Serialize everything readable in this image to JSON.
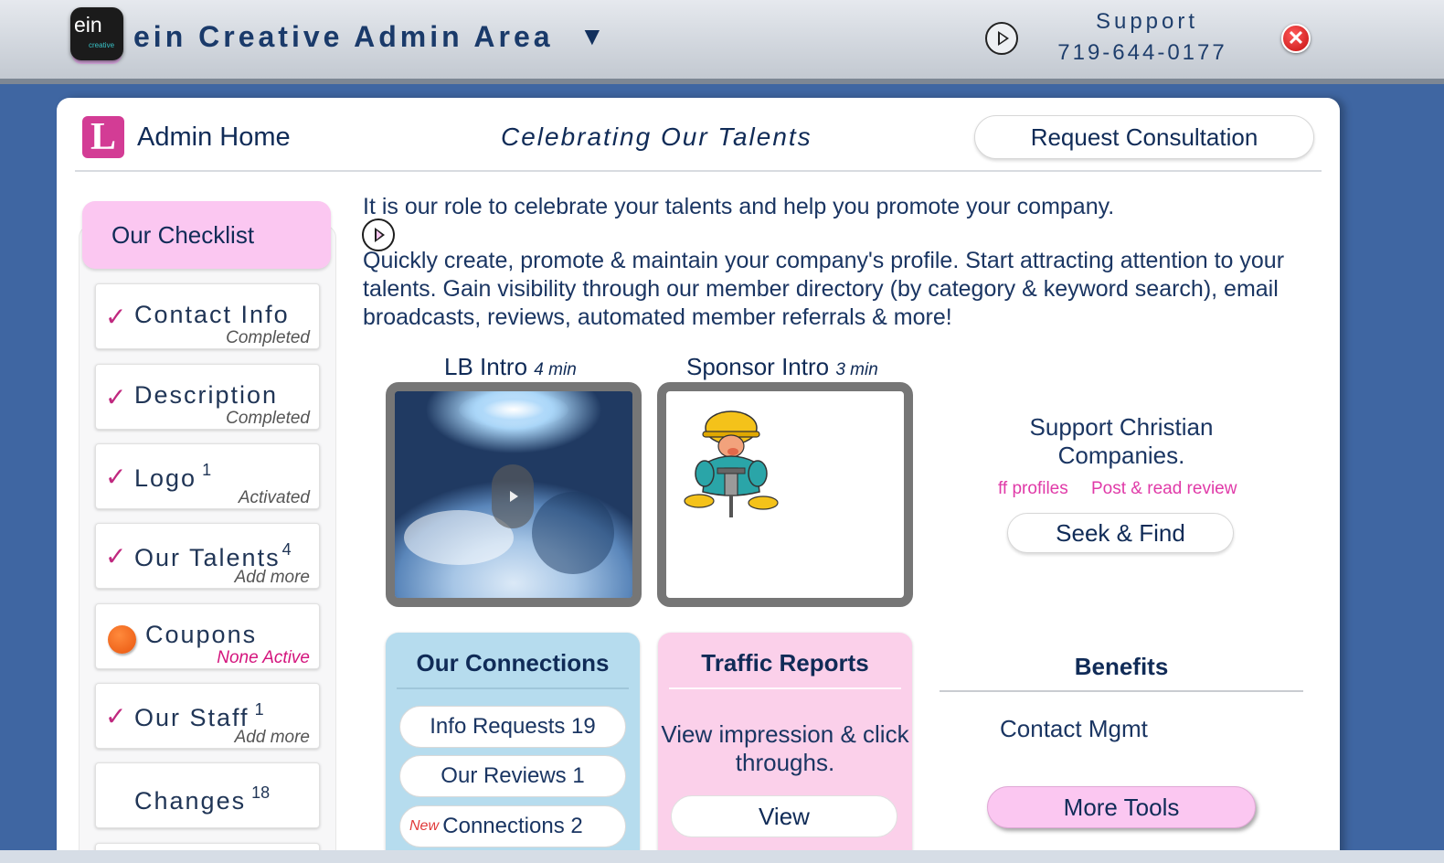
{
  "topbar": {
    "logo_text": "ein",
    "logo_subtext": "creative",
    "title": "ein Creative Admin Area",
    "caret": "▼",
    "support_label": "Support",
    "support_phone": "719-644-0177",
    "close_glyph": "✕"
  },
  "header": {
    "logo_letter": "L",
    "home_label": "Admin Home",
    "tagline": "Celebrating Our Talents",
    "consult_button": "Request Consultation"
  },
  "checklist": {
    "title": "Our Checklist",
    "items": [
      {
        "label": "Contact Info",
        "count": "",
        "status": "Completed",
        "marker": "check"
      },
      {
        "label": "Description",
        "count": "",
        "status": "Completed",
        "marker": "check"
      },
      {
        "label": "Logo",
        "count": "1",
        "status": "Activated",
        "marker": "check"
      },
      {
        "label": "Our Talents",
        "count": "4",
        "status": "Add more",
        "marker": "check"
      },
      {
        "label": "Coupons",
        "count": "",
        "status": "None Active",
        "marker": "orange-dot"
      },
      {
        "label": "Our Staff",
        "count": "1",
        "status": "Add more",
        "marker": "check"
      },
      {
        "label": "Changes",
        "count": "18",
        "status": "",
        "marker": "none"
      }
    ]
  },
  "intro": {
    "line1": "It is our role to celebrate your talents and help you promote your company.",
    "line2": "Quickly create, promote & maintain your company's profile. Start attracting attention to your talents. Gain visibility through our member directory (by category & keyword search), email broadcasts, reviews, automated member referrals & more!"
  },
  "videos": {
    "lb_title": "LB Intro",
    "lb_duration": "4 min",
    "sponsor_title": "Sponsor Intro",
    "sponsor_duration": "3 min"
  },
  "support_christian": {
    "text": "Support Christian Companies.",
    "link_profiles": "ff profiles",
    "link_reviews": "Post & read review",
    "seek_button": "Seek & Find"
  },
  "connections": {
    "title": "Our Connections",
    "info_requests": "Info Requests 19",
    "reviews": "Our Reviews 1",
    "new_badge": "New",
    "connections": "Connections 2"
  },
  "traffic": {
    "title": "Traffic Reports",
    "description": "View impression & click throughs.",
    "view_button": "View"
  },
  "benefits": {
    "title": "Benefits",
    "contact_mgmt": "Contact Mgmt",
    "more_tools": "More Tools"
  },
  "colors": {
    "page_bg": "#3f66a2",
    "pink_accent": "#fbc7f1",
    "blue_card": "#b6dcee",
    "check_magenta": "#c0287f",
    "link_pink": "#e03aa8",
    "navy_text": "#102b57"
  },
  "icons": {
    "logo": "ein-logo-icon",
    "top_play": "play-circle-icon",
    "close": "close-icon",
    "checklist_play": "play-circle-icon",
    "check": "checkmark-icon",
    "coupon_dot": "orange-dot-icon"
  }
}
